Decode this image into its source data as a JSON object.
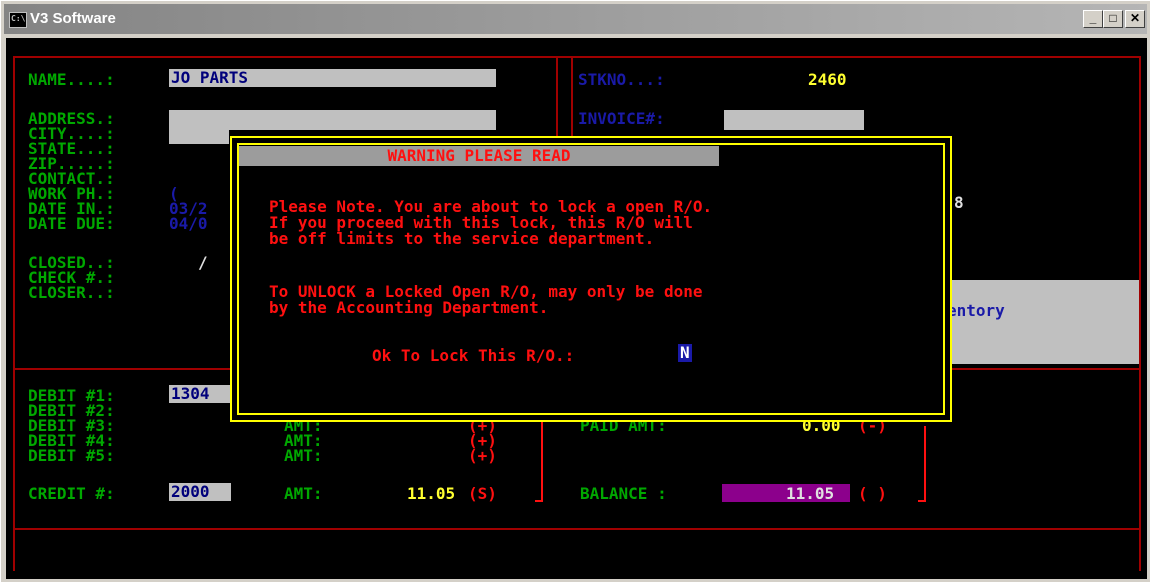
{
  "window": {
    "icon_text": "C:\\",
    "title": "V3 Software",
    "min": "_",
    "max": "□",
    "close": "✕"
  },
  "labels": {
    "name": "NAME....:",
    "address": "ADDRESS.:",
    "city": "CITY....:",
    "state": "STATE...:",
    "zip": "ZIP.....:",
    "contact": "CONTACT.:",
    "work_ph": "WORK PH.:",
    "date_in": "DATE IN.:",
    "date_due": "DATE DUE:",
    "closed": "CLOSED..:",
    "check": "CHECK #.:",
    "closer": "CLOSER..:",
    "stkno": "STKNO...:",
    "invoice": "INVOICE#:",
    "debit1": "DEBIT #1:",
    "debit2": "DEBIT #2:",
    "debit3": "DEBIT #3:",
    "debit4": "DEBIT #4:",
    "debit5": "DEBIT #5:",
    "credit": "CREDIT #:",
    "amt": "AMT:",
    "paid_amt": "PAID AMT:",
    "balance": "BALANCE :"
  },
  "values": {
    "name": "JO PARTS",
    "stkno": "2460",
    "work_ph": "(",
    "date_in": "03/2",
    "date_due": "04/0",
    "closed": "/",
    "debit1": "1304",
    "credit": "2000",
    "credit_amt": "11.05",
    "credit_sign": "(S)",
    "debit_sign": "(+)",
    "paid_amt": "0.00",
    "paid_sign": "(-)",
    "balance": "11.05",
    "balance_sign": "( )",
    "contact_edge": "8",
    "inventory_text": "entory"
  },
  "dialog": {
    "header": "WARNING PLEASE READ",
    "line1": "Please Note. You are about to lock a open R/O.",
    "line2": "If you proceed with this lock, this R/O will",
    "line3": "be off limits to the service department.",
    "line4": "To UNLOCK a Locked Open R/O, may only be done",
    "line5": "by the Accounting Department.",
    "prompt": "Ok To Lock This R/O.:",
    "answer": "N"
  }
}
